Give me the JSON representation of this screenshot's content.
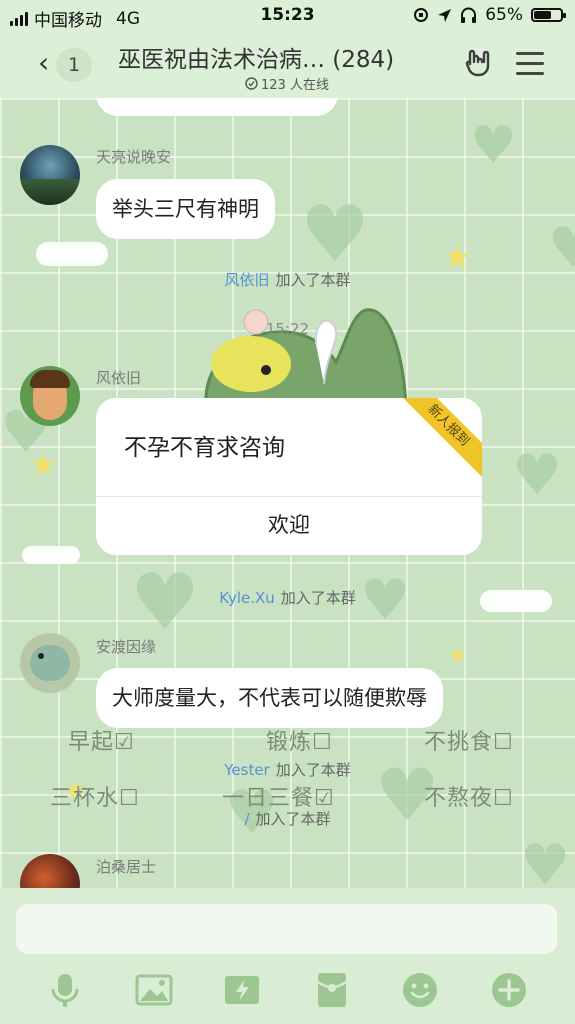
{
  "status": {
    "carrier": "中国移动",
    "network": "4G",
    "time": "15:23",
    "battery": "65%",
    "battery_level": 0.65
  },
  "nav": {
    "back_count": "1",
    "title": "巫医祝由法术治病… (284)",
    "online": "123 人在线"
  },
  "messages": [
    {
      "sender": "天亮说晚安",
      "text": "举头三尺有神明"
    },
    {
      "sender": "风依旧",
      "card_title": "不孕不育求咨询",
      "card_action": "欢迎",
      "ribbon": "新人报到"
    },
    {
      "sender": "安渡因缘",
      "text": "大师度量大，不代表可以随便欺辱"
    },
    {
      "sender": "泊桑居士"
    }
  ],
  "system": [
    {
      "who": "风依旧",
      "text": "加入了本群"
    },
    {
      "who": "Kyle.Xu",
      "text": "加入了本群"
    },
    {
      "who": "Yester",
      "text": "加入了本群"
    },
    {
      "who": "/",
      "text": "加入了本群"
    }
  ],
  "timestamp": "15:22",
  "checklist": {
    "row1": [
      "早起",
      "锻炼",
      "不挑食"
    ],
    "row2": [
      "三杯水",
      "一日三餐",
      "不熬夜"
    ],
    "row1_marks": [
      "☑",
      "☐",
      "☐"
    ],
    "row2_marks": [
      "☐",
      "☑",
      "☐"
    ]
  },
  "icons": {
    "toolbar": [
      "microphone-icon",
      "image-icon",
      "flash-icon",
      "red-packet-icon",
      "emoji-icon",
      "plus-icon"
    ]
  }
}
